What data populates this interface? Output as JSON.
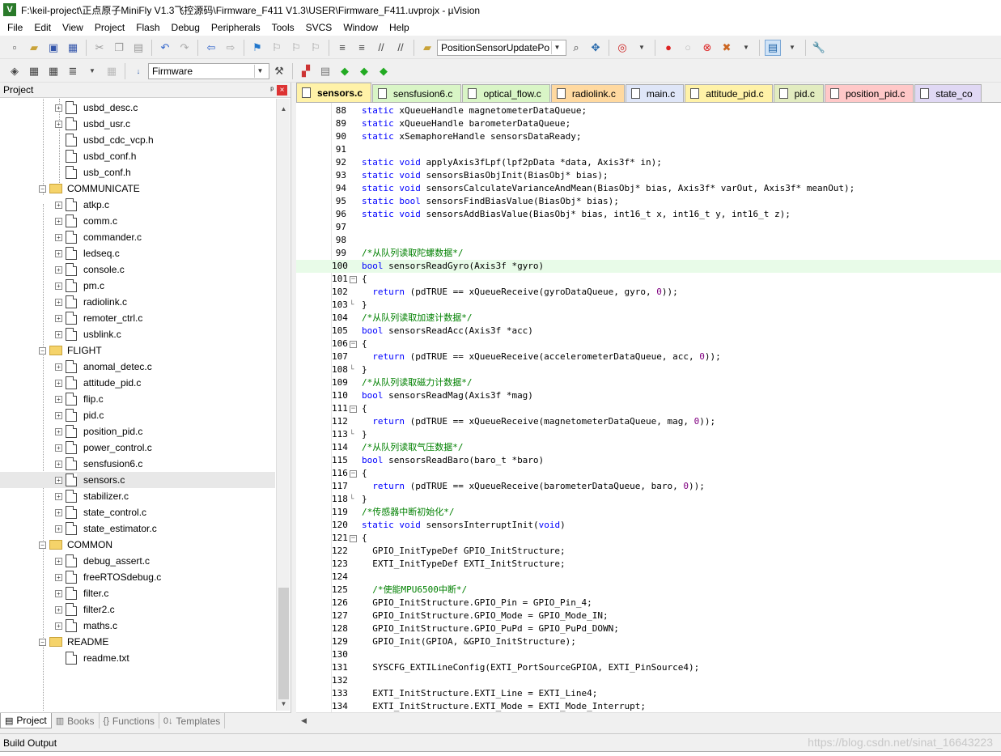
{
  "window": {
    "title": "F:\\keil-project\\正点原子MiniFly V1.3飞控源码\\Firmware_F411 V1.3\\USER\\Firmware_F411.uvprojx - µVision",
    "app_icon": "V"
  },
  "menu": [
    "File",
    "Edit",
    "View",
    "Project",
    "Flash",
    "Debug",
    "Peripherals",
    "Tools",
    "SVCS",
    "Window",
    "Help"
  ],
  "toolbar1": {
    "find_combo_value": "PositionSensorUpdatePo"
  },
  "toolbar2": {
    "target_combo_value": "Firmware"
  },
  "project_panel": {
    "title": "Project",
    "pin_glyph": "ᵖ",
    "close_glyph": "×",
    "tree": [
      {
        "label": "usbd_desc.c",
        "kind": "file",
        "expandable": true
      },
      {
        "label": "usbd_usr.c",
        "kind": "file",
        "expandable": true
      },
      {
        "label": "usbd_cdc_vcp.h",
        "kind": "file",
        "expandable": false
      },
      {
        "label": "usbd_conf.h",
        "kind": "file",
        "expandable": false
      },
      {
        "label": "usb_conf.h",
        "kind": "file",
        "expandable": false
      },
      {
        "label": "COMMUNICATE",
        "kind": "group",
        "expandable": true
      },
      {
        "label": "atkp.c",
        "kind": "file",
        "expandable": true
      },
      {
        "label": "comm.c",
        "kind": "file",
        "expandable": true
      },
      {
        "label": "commander.c",
        "kind": "file",
        "expandable": true
      },
      {
        "label": "ledseq.c",
        "kind": "file",
        "expandable": true
      },
      {
        "label": "console.c",
        "kind": "file",
        "expandable": true
      },
      {
        "label": "pm.c",
        "kind": "file",
        "expandable": true
      },
      {
        "label": "radiolink.c",
        "kind": "file",
        "expandable": true
      },
      {
        "label": "remoter_ctrl.c",
        "kind": "file",
        "expandable": true
      },
      {
        "label": "usblink.c",
        "kind": "file",
        "expandable": true
      },
      {
        "label": "FLIGHT",
        "kind": "group",
        "expandable": true
      },
      {
        "label": "anomal_detec.c",
        "kind": "file",
        "expandable": true
      },
      {
        "label": "attitude_pid.c",
        "kind": "file",
        "expandable": true
      },
      {
        "label": "flip.c",
        "kind": "file",
        "expandable": true
      },
      {
        "label": "pid.c",
        "kind": "file",
        "expandable": true
      },
      {
        "label": "position_pid.c",
        "kind": "file",
        "expandable": true
      },
      {
        "label": "power_control.c",
        "kind": "file",
        "expandable": true
      },
      {
        "label": "sensfusion6.c",
        "kind": "file",
        "expandable": true
      },
      {
        "label": "sensors.c",
        "kind": "file",
        "expandable": true,
        "selected": true
      },
      {
        "label": "stabilizer.c",
        "kind": "file",
        "expandable": true
      },
      {
        "label": "state_control.c",
        "kind": "file",
        "expandable": true
      },
      {
        "label": "state_estimator.c",
        "kind": "file",
        "expandable": true
      },
      {
        "label": "COMMON",
        "kind": "group",
        "expandable": true
      },
      {
        "label": "debug_assert.c",
        "kind": "file",
        "expandable": true
      },
      {
        "label": "freeRTOSdebug.c",
        "kind": "file",
        "expandable": true
      },
      {
        "label": "filter.c",
        "kind": "file",
        "expandable": true
      },
      {
        "label": "filter2.c",
        "kind": "file",
        "expandable": true
      },
      {
        "label": "maths.c",
        "kind": "file",
        "expandable": true
      },
      {
        "label": "README",
        "kind": "group",
        "expandable": true
      },
      {
        "label": "readme.txt",
        "kind": "file",
        "expandable": false
      }
    ],
    "tabs": [
      {
        "label": "Project",
        "icon": "▤",
        "active": true
      },
      {
        "label": "Books",
        "icon": "▥",
        "active": false
      },
      {
        "label": "Functions",
        "icon": "{}",
        "active": false
      },
      {
        "label": "Templates",
        "icon": "0↓",
        "active": false
      }
    ]
  },
  "editor": {
    "tabs": [
      {
        "label": "sensors.c",
        "color": "#fff2a8",
        "active": true
      },
      {
        "label": "sensfusion6.c",
        "color": "#d9f5c6",
        "active": false
      },
      {
        "label": "optical_flow.c",
        "color": "#d9f5c6",
        "active": false
      },
      {
        "label": "radiolink.c",
        "color": "#ffd9a0",
        "active": false
      },
      {
        "label": "main.c",
        "color": "#dfe6f8",
        "active": false
      },
      {
        "label": "attitude_pid.c",
        "color": "#fff2a8",
        "active": false
      },
      {
        "label": "pid.c",
        "color": "#e2ecc0",
        "active": false
      },
      {
        "label": "position_pid.c",
        "color": "#ffc8c8",
        "active": false
      },
      {
        "label": "state_co",
        "color": "#e0d8f4",
        "active": false
      }
    ],
    "current_line": 100,
    "lines": [
      {
        "n": 88,
        "text": "static xQueueHandle magnetometerDataQueue;"
      },
      {
        "n": 89,
        "text": "static xQueueHandle barometerDataQueue;"
      },
      {
        "n": 90,
        "text": "static xSemaphoreHandle sensorsDataReady;"
      },
      {
        "n": 91,
        "text": ""
      },
      {
        "n": 92,
        "text": "static void applyAxis3fLpf(lpf2pData *data, Axis3f* in);"
      },
      {
        "n": 93,
        "text": "static void sensorsBiasObjInit(BiasObj* bias);"
      },
      {
        "n": 94,
        "text": "static void sensorsCalculateVarianceAndMean(BiasObj* bias, Axis3f* varOut, Axis3f* meanOut);"
      },
      {
        "n": 95,
        "text": "static bool sensorsFindBiasValue(BiasObj* bias);"
      },
      {
        "n": 96,
        "text": "static void sensorsAddBiasValue(BiasObj* bias, int16_t x, int16_t y, int16_t z);"
      },
      {
        "n": 97,
        "text": ""
      },
      {
        "n": 98,
        "text": ""
      },
      {
        "n": 99,
        "text": "/*从队列读取陀螺数据*/"
      },
      {
        "n": 100,
        "text": "bool sensorsReadGyro(Axis3f *gyro)"
      },
      {
        "n": 101,
        "text": "{",
        "fold": "open"
      },
      {
        "n": 102,
        "text": "  return (pdTRUE == xQueueReceive(gyroDataQueue, gyro, 0));"
      },
      {
        "n": 103,
        "text": "}",
        "fold": "end"
      },
      {
        "n": 104,
        "text": "/*从队列读取加速计数据*/"
      },
      {
        "n": 105,
        "text": "bool sensorsReadAcc(Axis3f *acc)"
      },
      {
        "n": 106,
        "text": "{",
        "fold": "open"
      },
      {
        "n": 107,
        "text": "  return (pdTRUE == xQueueReceive(accelerometerDataQueue, acc, 0));"
      },
      {
        "n": 108,
        "text": "}",
        "fold": "end"
      },
      {
        "n": 109,
        "text": "/*从队列读取磁力计数据*/"
      },
      {
        "n": 110,
        "text": "bool sensorsReadMag(Axis3f *mag)"
      },
      {
        "n": 111,
        "text": "{",
        "fold": "open"
      },
      {
        "n": 112,
        "text": "  return (pdTRUE == xQueueReceive(magnetometerDataQueue, mag, 0));"
      },
      {
        "n": 113,
        "text": "}",
        "fold": "end"
      },
      {
        "n": 114,
        "text": "/*从队列读取气压数据*/"
      },
      {
        "n": 115,
        "text": "bool sensorsReadBaro(baro_t *baro)"
      },
      {
        "n": 116,
        "text": "{",
        "fold": "open"
      },
      {
        "n": 117,
        "text": "  return (pdTRUE == xQueueReceive(barometerDataQueue, baro, 0));"
      },
      {
        "n": 118,
        "text": "}",
        "fold": "end"
      },
      {
        "n": 119,
        "text": "/*传感器中断初始化*/"
      },
      {
        "n": 120,
        "text": "static void sensorsInterruptInit(void)"
      },
      {
        "n": 121,
        "text": "{",
        "fold": "open"
      },
      {
        "n": 122,
        "text": "  GPIO_InitTypeDef GPIO_InitStructure;"
      },
      {
        "n": 123,
        "text": "  EXTI_InitTypeDef EXTI_InitStructure;"
      },
      {
        "n": 124,
        "text": ""
      },
      {
        "n": 125,
        "text": "  /*使能MPU6500中断*/"
      },
      {
        "n": 126,
        "text": "  GPIO_InitStructure.GPIO_Pin = GPIO_Pin_4;"
      },
      {
        "n": 127,
        "text": "  GPIO_InitStructure.GPIO_Mode = GPIO_Mode_IN;"
      },
      {
        "n": 128,
        "text": "  GPIO_InitStructure.GPIO_PuPd = GPIO_PuPd_DOWN;"
      },
      {
        "n": 129,
        "text": "  GPIO_Init(GPIOA, &GPIO_InitStructure);"
      },
      {
        "n": 130,
        "text": ""
      },
      {
        "n": 131,
        "text": "  SYSCFG_EXTILineConfig(EXTI_PortSourceGPIOA, EXTI_PinSource4);"
      },
      {
        "n": 132,
        "text": ""
      },
      {
        "n": 133,
        "text": "  EXTI_InitStructure.EXTI_Line = EXTI_Line4;"
      },
      {
        "n": 134,
        "text": "  EXTI_InitStructure.EXTI_Mode = EXTI_Mode_Interrupt;"
      }
    ]
  },
  "build_output": {
    "title": "Build Output"
  },
  "watermark": "https://blog.csdn.net/sinat_16643223"
}
